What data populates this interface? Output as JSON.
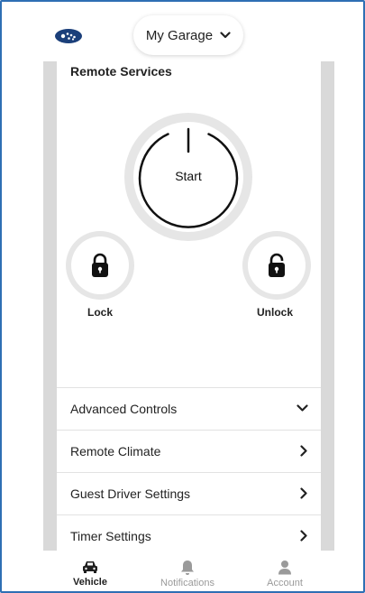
{
  "header": {
    "garage_label": "My Garage",
    "logo_icon": "subaru-logo-icon",
    "dropdown_icon": "chevron-down-icon"
  },
  "remote_services": {
    "title": "Remote Services",
    "start_label": "Start",
    "lock_label": "Lock",
    "unlock_label": "Unlock"
  },
  "menu": [
    {
      "label": "Advanced Controls",
      "icon": "chevron-down-icon"
    },
    {
      "label": "Remote Climate",
      "icon": "chevron-right-icon"
    },
    {
      "label": "Guest Driver Settings",
      "icon": "chevron-right-icon"
    },
    {
      "label": "Timer Settings",
      "icon": "chevron-right-icon"
    }
  ],
  "bottom_nav": [
    {
      "label": "Vehicle",
      "icon": "car-icon",
      "active": true
    },
    {
      "label": "Notifications",
      "icon": "bell-icon",
      "active": false
    },
    {
      "label": "Account",
      "icon": "person-icon",
      "active": false
    }
  ],
  "colors": {
    "frame_border": "#2e6fb4",
    "active_nav": "#1f1f1f",
    "inactive_nav": "#9a9a9a",
    "ring": "#e6e6e6",
    "logo_blue": "#1b3f7a"
  }
}
